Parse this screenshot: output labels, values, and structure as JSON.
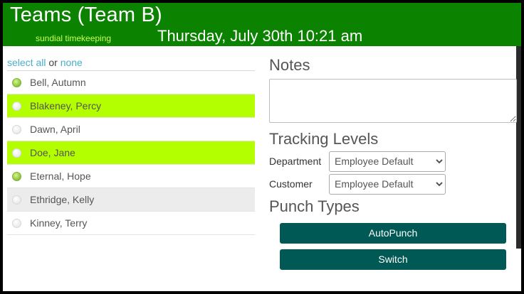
{
  "header": {
    "title": "Teams (Team B)",
    "brand": "sundial timekeeping",
    "datetime": "Thursday, July 30th 10:21 am",
    "bg_color": "#0b8200",
    "brand_color": "#c6ff5a"
  },
  "selection": {
    "select_all": "select all",
    "connector": "or",
    "none": "none"
  },
  "employees": [
    {
      "name": "Bell, Autumn",
      "status": "active",
      "highlight": "none"
    },
    {
      "name": "Blakeney, Percy",
      "status": "inactive",
      "highlight": "green"
    },
    {
      "name": "Dawn, April",
      "status": "inactive",
      "highlight": "none"
    },
    {
      "name": "Doe, Jane",
      "status": "inactive",
      "highlight": "green"
    },
    {
      "name": "Eternal, Hope",
      "status": "active",
      "highlight": "none"
    },
    {
      "name": "Ethridge, Kelly",
      "status": "inactive",
      "highlight": "gray"
    },
    {
      "name": "Kinney, Terry",
      "status": "inactive",
      "highlight": "none"
    }
  ],
  "notes": {
    "label": "Notes",
    "value": ""
  },
  "tracking": {
    "label": "Tracking Levels",
    "department": {
      "label": "Department",
      "selected": "Employee Default"
    },
    "customer": {
      "label": "Customer",
      "selected": "Employee Default"
    }
  },
  "punch": {
    "label": "Punch Types",
    "buttons": [
      "AutoPunch",
      "Switch"
    ],
    "button_color": "#005954"
  },
  "colors": {
    "row_highlight_green": "#b3ff00",
    "row_highlight_gray": "#ececec",
    "link": "#4aaec8"
  }
}
